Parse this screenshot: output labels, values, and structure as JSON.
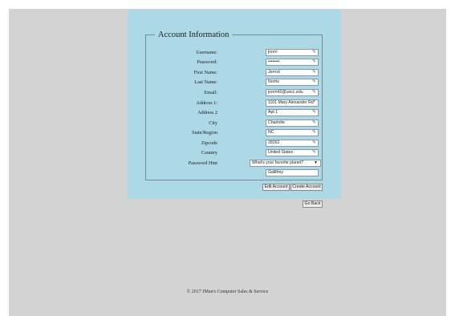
{
  "form": {
    "legend": "Account Information",
    "fields": [
      {
        "label": "Username:",
        "value": "jnorri",
        "pencil": "✎"
      },
      {
        "label": "Password:",
        "value": "••••••••",
        "pencil": "✎"
      },
      {
        "label": "First Name:",
        "value": "Jerrod",
        "pencil": "✎"
      },
      {
        "label": "Last Name:",
        "value": "Norris",
        "pencil": "✎"
      },
      {
        "label": "Email:",
        "value": "jnorri42@uncc.edu",
        "pencil": "✎"
      },
      {
        "label": "Address 1:",
        "value": "1101 Mary Alexander Rd*",
        "pencil": ""
      },
      {
        "label": "Address 2",
        "value": "Apt 1",
        "pencil": "✎"
      },
      {
        "label": "City",
        "value": "Charlotte",
        "pencil": "✎"
      },
      {
        "label": "State/Region",
        "value": "NC",
        "pencil": "✎"
      },
      {
        "label": "Zipcode",
        "value": "28262",
        "pencil": "✎"
      },
      {
        "label": "Country",
        "value": "United States",
        "pencil": "✎"
      }
    ],
    "password_hint_label": "Password Hint",
    "hint_question": "What's your favorite planet?",
    "hint_answer": "Gallifrey"
  },
  "buttons": {
    "edit_account": "Edit Account",
    "create_account": "Create Account",
    "go_back": "Go Back"
  },
  "footer": "© 2017 JMan's Computer Sales & Service"
}
